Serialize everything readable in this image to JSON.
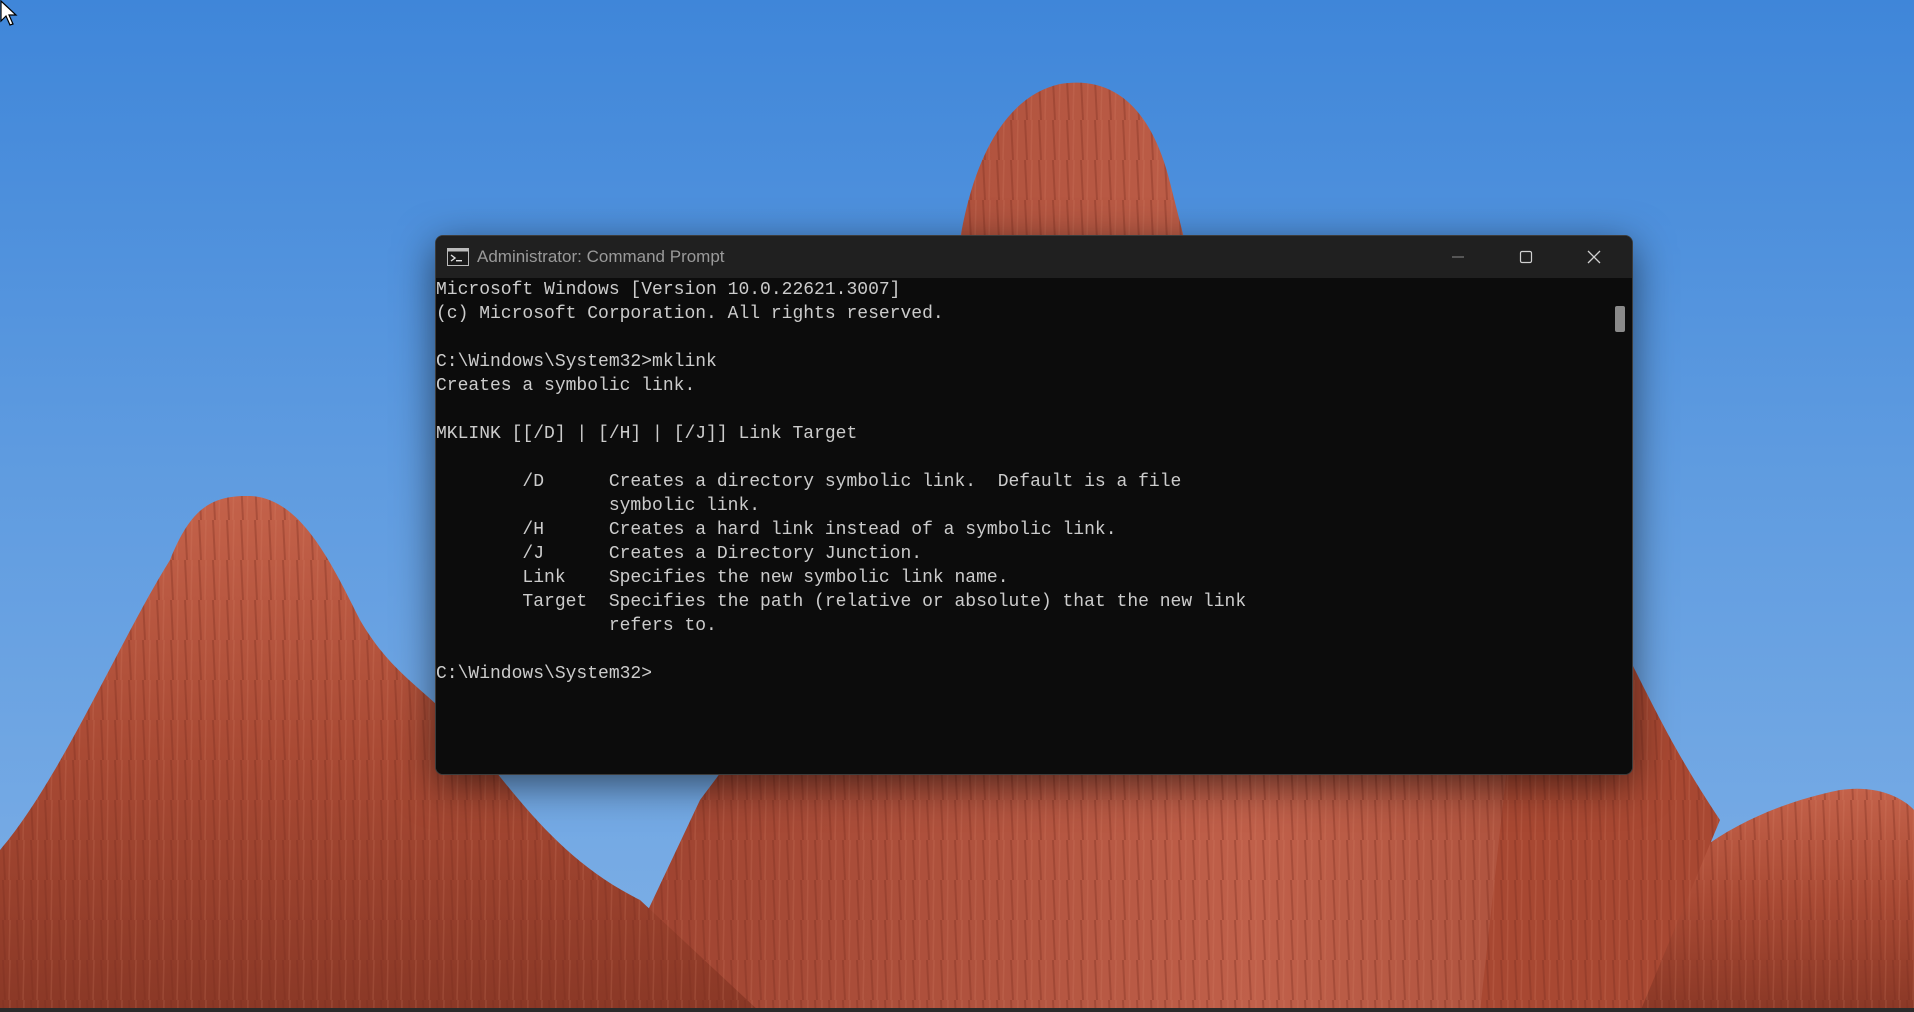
{
  "window": {
    "title": "Administrator: Command Prompt",
    "icon": "cmd-icon"
  },
  "controls": {
    "minimize_icon": "minimize-icon",
    "maximize_icon": "maximize-icon",
    "close_icon": "close-icon"
  },
  "console": {
    "lines": [
      "Microsoft Windows [Version 10.0.22621.3007]",
      "(c) Microsoft Corporation. All rights reserved.",
      "",
      "C:\\Windows\\System32>mklink",
      "Creates a symbolic link.",
      "",
      "MKLINK [[/D] | [/H] | [/J]] Link Target",
      "",
      "        /D      Creates a directory symbolic link.  Default is a file",
      "                symbolic link.",
      "        /H      Creates a hard link instead of a symbolic link.",
      "        /J      Creates a Directory Junction.",
      "        Link    Specifies the new symbolic link name.",
      "        Target  Specifies the path (relative or absolute) that the new link",
      "                refers to.",
      "",
      "C:\\Windows\\System32>"
    ]
  },
  "colors": {
    "console_bg": "#0c0c0c",
    "console_text": "#cccccc",
    "titlebar_bg": "#202020",
    "sky": "#4a8ddb",
    "rock": "#b5523c"
  }
}
